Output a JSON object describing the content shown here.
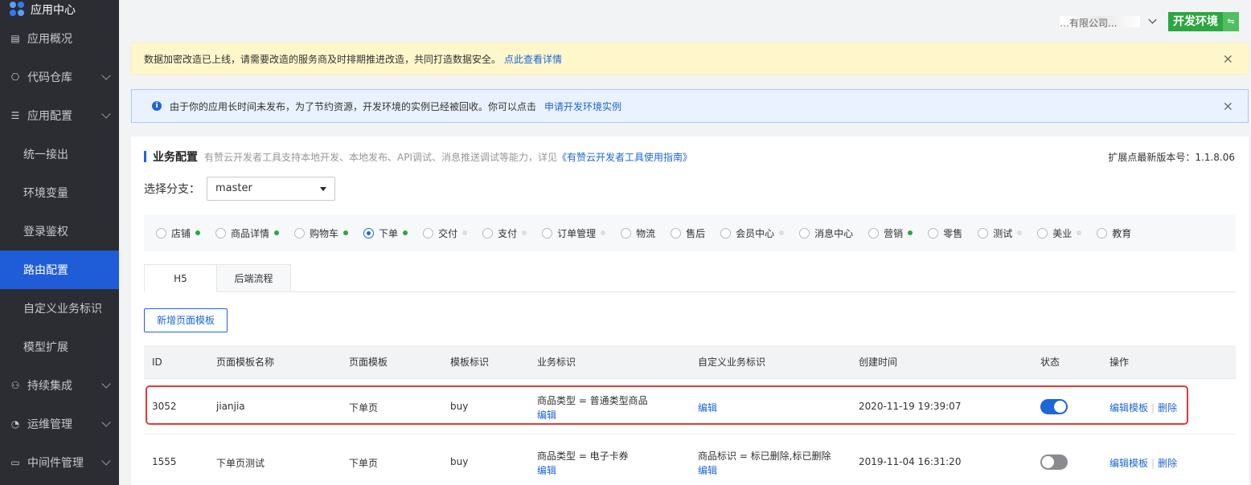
{
  "brand": {
    "title": "应用中心"
  },
  "sidebar": {
    "items": [
      {
        "label": "应用概况",
        "icon": "overview-icon",
        "glyph": "▤",
        "sub": false,
        "chevron": false
      },
      {
        "label": "代码仓库",
        "icon": "code-repo-icon",
        "glyph": "⎔",
        "sub": false,
        "chevron": true
      },
      {
        "label": "应用配置",
        "icon": "sliders-icon",
        "glyph": "☰",
        "sub": false,
        "chevron": true
      },
      {
        "label": "统一接出",
        "sub": true
      },
      {
        "label": "环境变量",
        "sub": true
      },
      {
        "label": "登录鉴权",
        "sub": true
      },
      {
        "label": "路由配置",
        "sub": true,
        "active": true
      },
      {
        "label": "自定义业务标识",
        "sub": true
      },
      {
        "label": "模型扩展",
        "sub": true
      },
      {
        "label": "持续集成",
        "icon": "ci-icon",
        "glyph": "⚇",
        "sub": false,
        "chevron": true
      },
      {
        "label": "运维管理",
        "icon": "gauge-icon",
        "glyph": "◔",
        "sub": false,
        "chevron": true
      },
      {
        "label": "中间件管理",
        "icon": "middleware-icon",
        "glyph": "▭",
        "sub": false,
        "chevron": true
      }
    ]
  },
  "topbar": {
    "user": "…有限公司...",
    "env_label": "开发环境",
    "env_switch_glyph": "⇋"
  },
  "notices": {
    "yellow": {
      "text": "数据加密改造已上线，请需要改造的服务商及时排期推进改造，共同打造数据安全。",
      "link": "点此查看详情",
      "close": "×"
    },
    "blue": {
      "text": "由于你的应用长时间未发布，为了节约资源，开发环境的实例已经被回收。你可以点击",
      "link": "申请开发环境实例",
      "close": "×",
      "info_glyph": "i"
    }
  },
  "section": {
    "title": "业务配置",
    "desc": "有赞云开发者工具支持本地开发、本地发布、API调试、消息推送调试等能力，详见",
    "desc_link": "《有赞云开发者工具使用指南》",
    "version": "扩展点最新版本号：1.1.8.06"
  },
  "branch": {
    "label": "选择分支：",
    "value": "master"
  },
  "business": [
    {
      "label": "店铺",
      "dot": "#2da641",
      "checked": false
    },
    {
      "label": "商品详情",
      "dot": "#2da641",
      "checked": false
    },
    {
      "label": "购物车",
      "dot": "#2da641",
      "checked": false
    },
    {
      "label": "下单",
      "dot": "#2da641",
      "checked": true
    },
    {
      "label": "交付",
      "dot": "#dcdee0",
      "checked": false
    },
    {
      "label": "支付",
      "dot": "#dcdee0",
      "checked": false
    },
    {
      "label": "订单管理",
      "dot": "#dcdee0",
      "checked": false
    },
    {
      "label": "物流",
      "dot": "",
      "checked": false
    },
    {
      "label": "售后",
      "dot": "",
      "checked": false
    },
    {
      "label": "会员中心",
      "dot": "#dcdee0",
      "checked": false
    },
    {
      "label": "消息中心",
      "dot": "",
      "checked": false
    },
    {
      "label": "营销",
      "dot": "#2da641",
      "checked": false
    },
    {
      "label": "零售",
      "dot": "",
      "checked": false
    },
    {
      "label": "测试",
      "dot": "#dcdee0",
      "checked": false
    },
    {
      "label": "美业",
      "dot": "#dcdee0",
      "checked": false
    },
    {
      "label": "教育",
      "dot": "",
      "checked": false
    }
  ],
  "tabs": {
    "h5": "H5",
    "backend": "后端流程"
  },
  "add_button": "新增页面模板",
  "table": {
    "headers": [
      "ID",
      "页面模板名称",
      "页面模板",
      "模板标识",
      "业务标识",
      "自定义业务标识",
      "创建时间",
      "状态",
      "操作"
    ],
    "rows": [
      {
        "id": "3052",
        "name": "jianjia",
        "template": "下单页",
        "tag": "buy",
        "biz": "商品类型 = 普通类型商品",
        "biz_edit": "编辑",
        "custom": "",
        "custom_edit": "编辑",
        "created": "2020-11-19 19:39:07",
        "status_on": true,
        "action_edit": "编辑模板",
        "action_sep": "|",
        "action_delete": "删除"
      },
      {
        "id": "1555",
        "name": "下单页测试",
        "template": "下单页",
        "tag": "buy",
        "biz": "商品类型 = 电子卡券",
        "biz_edit": "编辑",
        "custom": "商品标识 = 标已删除,标已删除",
        "custom_edit": "编辑",
        "created": "2019-11-04 16:31:20",
        "status_on": false,
        "action_edit": "编辑模板",
        "action_sep": "|",
        "action_delete": "删除"
      }
    ]
  },
  "colors": {
    "accent": "#1b66d9",
    "sidebar_bg": "#2b2d33",
    "sidebar_active": "#1f5dd8",
    "env_green": "#2da641",
    "highlight": "#e53935"
  }
}
